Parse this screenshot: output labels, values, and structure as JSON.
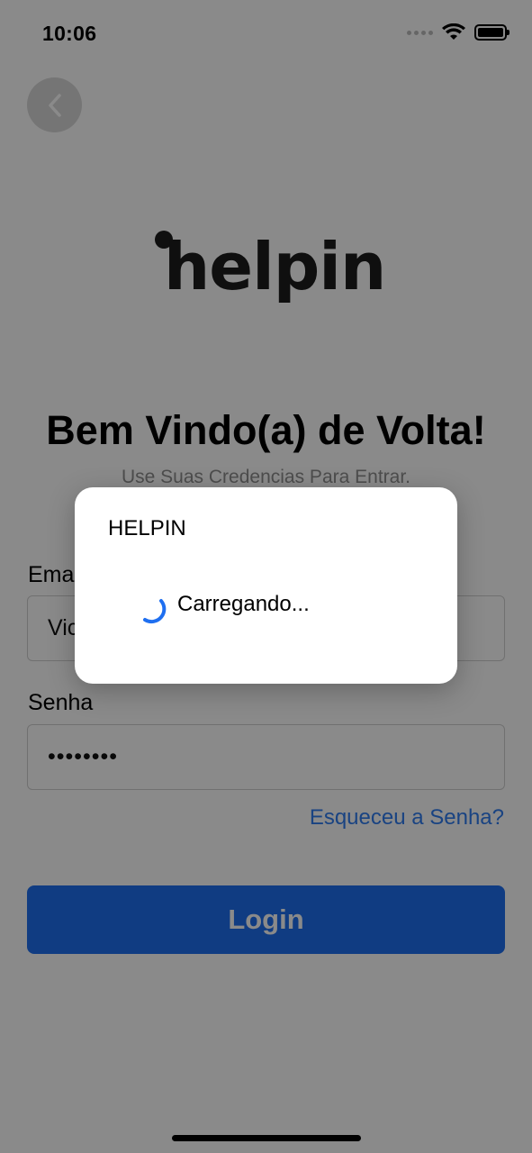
{
  "status_bar": {
    "time": "10:06"
  },
  "logo": {
    "text": "helpin"
  },
  "header": {
    "title": "Bem Vindo(a) de Volta!",
    "subtitle": "Use Suas Credencias Para Entrar."
  },
  "form": {
    "email_label": "Email",
    "email_value": "Vic",
    "password_label": "Senha",
    "password_value": "••••••••",
    "forgot_link": "Esqueceu a Senha?",
    "login_button": "Login"
  },
  "dialog": {
    "title": "HELPIN",
    "message": "Carregando..."
  },
  "colors": {
    "accent": "#1f6ff0",
    "overlay": "#000000",
    "spinner": "#1f6ff0"
  }
}
